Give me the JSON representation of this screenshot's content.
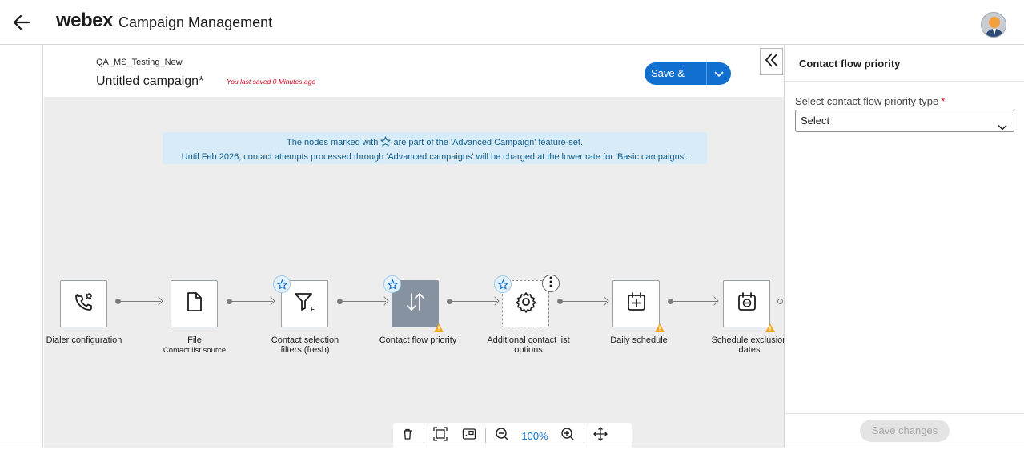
{
  "header": {
    "brand": "webex",
    "app_title": "Campaign Management"
  },
  "campaign": {
    "subtitle": "QA_MS_Testing_New",
    "name": "Untitled campaign*",
    "saved_note": "You last saved 0 Minutes ago",
    "save_exit_label": "Save & exit"
  },
  "banner": {
    "line1_pre": "The nodes marked with",
    "line1_post": "are part of the 'Advanced Campaign' feature-set.",
    "line2": "Until Feb 2026, contact attempts processed through 'Advanced campaigns' will be charged at the lower rate for 'Basic campaigns'."
  },
  "nodes": [
    {
      "label": "Dialer configuration",
      "icon": "phone-gear-icon",
      "advanced": false,
      "warning": false
    },
    {
      "label": "File",
      "sub": "Contact list source",
      "icon": "file-icon",
      "advanced": false,
      "warning": false
    },
    {
      "label": "Contact selection filters (fresh)",
      "icon": "filter-icon",
      "advanced": true,
      "warning": false
    },
    {
      "label": "Contact flow priority",
      "icon": "sort-arrows-icon",
      "advanced": true,
      "warning": true,
      "selected": true
    },
    {
      "label": "Additional contact list options",
      "icon": "gear-icon",
      "advanced": true,
      "warning": false
    },
    {
      "label": "Daily schedule",
      "icon": "calendar-plus-icon",
      "advanced": false,
      "warning": true
    },
    {
      "label": "Schedule exclusion dates",
      "icon": "calendar-minus-icon",
      "advanced": false,
      "warning": true
    }
  ],
  "toolbar": {
    "zoom": "100%",
    "tools": [
      "delete-icon",
      "fit-view-icon",
      "minimap-icon",
      "zoom-out-icon",
      "zoom-in-icon",
      "pan-icon"
    ]
  },
  "panel": {
    "title": "Contact flow priority",
    "field_label": "Select contact flow priority type",
    "required_mark": "*",
    "select_value": "Select",
    "save_changes_label": "Save changes"
  },
  "colors": {
    "primary": "#1170cf",
    "selected_node": "#8792a0",
    "warning": "#f5a623",
    "banner_bg": "#d7ecf7",
    "canvas_bg": "#ededed"
  }
}
